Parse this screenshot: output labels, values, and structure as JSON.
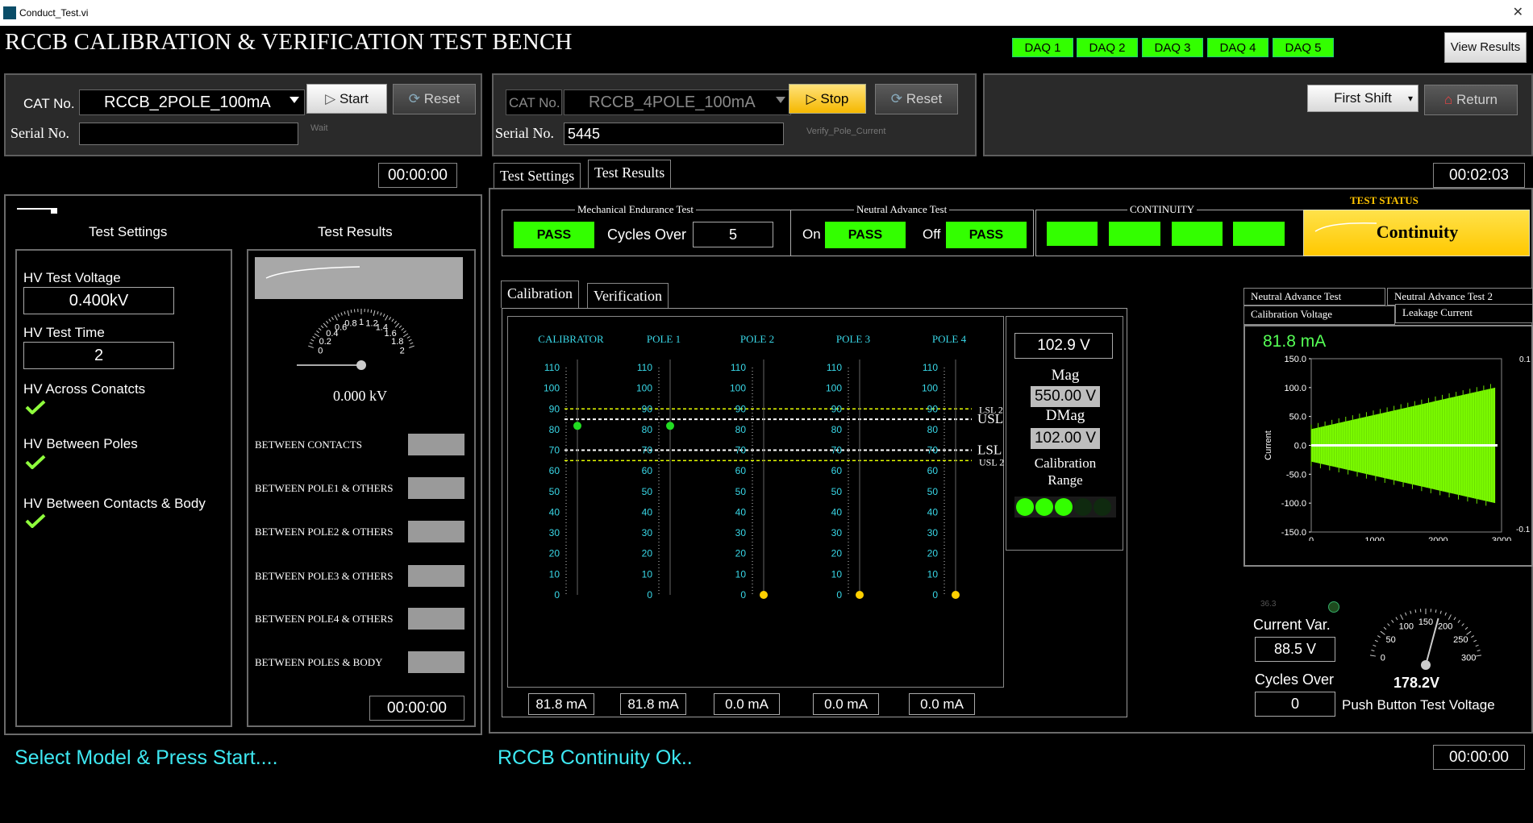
{
  "window": {
    "title": "Conduct_Test.vi"
  },
  "app_title": "RCCB CALIBRATION & VERIFICATION TEST BENCH",
  "daq": [
    "DAQ 1",
    "DAQ 2",
    "DAQ 3",
    "DAQ 4",
    "DAQ 5"
  ],
  "view_results": "View Results",
  "left_station": {
    "cat_label": "CAT No.",
    "cat_value": "RCCB_2POLE_100mA",
    "start": "Start",
    "reset": "Reset",
    "serial_label": "Serial No.",
    "serial_value": "",
    "status_small": "Wait",
    "timer": "00:00:00"
  },
  "right_station": {
    "cat_label": "CAT No.",
    "cat_value": "RCCB_4POLE_100mA",
    "stop": "Stop",
    "reset": "Reset",
    "serial_label": "Serial No.",
    "serial_value": "5445",
    "status_small": "Verify_Pole_Current",
    "timer": "00:02:03"
  },
  "shift": {
    "value": "First Shift",
    "return": "Return"
  },
  "test_settings": {
    "title": "Test Settings",
    "hv_voltage_label": "HV Test Voltage",
    "hv_voltage_value": "0.400kV",
    "hv_time_label": "HV Test Time",
    "hv_time_value": "2",
    "hv_across": "HV Across Conatcts",
    "hv_between_poles": "HV Between Poles",
    "hv_contacts_body": "HV Between Contacts & Body"
  },
  "test_results": {
    "title": "Test Results",
    "gauge_ticks": [
      "0",
      "0.2",
      "0.4",
      "0.6",
      "0.8",
      "1",
      "1.2",
      "1.4",
      "1.6",
      "1.8",
      "2"
    ],
    "gauge_value": "0.000 kV",
    "rows": [
      "BETWEEN CONTACTS",
      "BETWEEN POLE1 & OTHERS",
      "BETWEEN POLE2 & OTHERS",
      "BETWEEN POLE3 & OTHERS",
      "BETWEEN POLE4 & OTHERS",
      "BETWEEN POLES & BODY"
    ],
    "timer": "00:00:00"
  },
  "tabs_main": [
    "Test Settings",
    "Test Results"
  ],
  "mech": {
    "title": "Mechanical Endurance Test",
    "status": "PASS",
    "cycles_label": "Cycles Over",
    "cycles_value": "5"
  },
  "neutral": {
    "title": "Neutral Advance Test",
    "on_label": "On",
    "on_status": "PASS",
    "off_label": "Off",
    "off_status": "PASS"
  },
  "continuity": {
    "title": "CONTINUITY"
  },
  "test_status": {
    "title": "TEST STATUS",
    "value": "Continuity"
  },
  "cal_tabs": [
    "Calibration",
    "Verification"
  ],
  "columns": [
    {
      "name": "CALIBRATOR",
      "reading": "81.8 mA",
      "value": 81.8
    },
    {
      "name": "POLE 1",
      "reading": "81.8 mA",
      "value": 81.8
    },
    {
      "name": "POLE 2",
      "reading": "0.0 mA",
      "value": 0
    },
    {
      "name": "POLE 3",
      "reading": "0.0 mA",
      "value": 0
    },
    {
      "name": "POLE 4",
      "reading": "0.0 mA",
      "value": 0
    }
  ],
  "scale_ticks": [
    "110",
    "100",
    "90",
    "80",
    "70",
    "60",
    "50",
    "40",
    "30",
    "20",
    "10",
    "0"
  ],
  "limits": {
    "lsl2_top_label": "LSL 2",
    "usl_label": "USL",
    "lsl_label": "LSL",
    "usl2_label": "USL 2",
    "lsl2_top": 90,
    "usl": 85,
    "lsl": 70,
    "usl2": 65
  },
  "calib": {
    "voltage": "102.9 V",
    "mag_label": "Mag",
    "mag_value": "550.00 V",
    "dmag_label": "DMag",
    "dmag_value": "102.00 V",
    "range_label1": "Calibration",
    "range_label2": "Range"
  },
  "waveform": {
    "tabs_row1": [
      "Neutral Advance Test",
      "Neutral Advance Test 2"
    ],
    "tabs_row2": [
      "Calibration Voltage",
      "Leakage Current"
    ],
    "reading": "81.8 mA",
    "ylabel": "Current",
    "yticks": [
      "150.0",
      "100.0",
      "50.0",
      "0.0",
      "-50.0",
      "-100.0",
      "-150.0"
    ],
    "xticks": [
      "0",
      "1000",
      "2000",
      "3000"
    ],
    "y2ticks": [
      "0.1",
      "-0.1"
    ]
  },
  "push_button": {
    "current_var_label": "Current Var.",
    "current_var_value": "88.5 V",
    "cycles_label": "Cycles Over",
    "cycles_value": "0",
    "small_val": "36.3",
    "gauge_ticks": [
      "0",
      "50",
      "100",
      "150",
      "200",
      "250",
      "300"
    ],
    "gauge_value": "178.2V",
    "gauge_label": "Push Button Test Voltage"
  },
  "status_left": "Select Model & Press Start....",
  "status_right": "RCCB Continuity Ok..",
  "bottom_timer": "00:00:00",
  "colors": {
    "accent_green": "#33ff00",
    "cyan_text": "#3ee8f2",
    "status_yellow": "#ffd000"
  }
}
